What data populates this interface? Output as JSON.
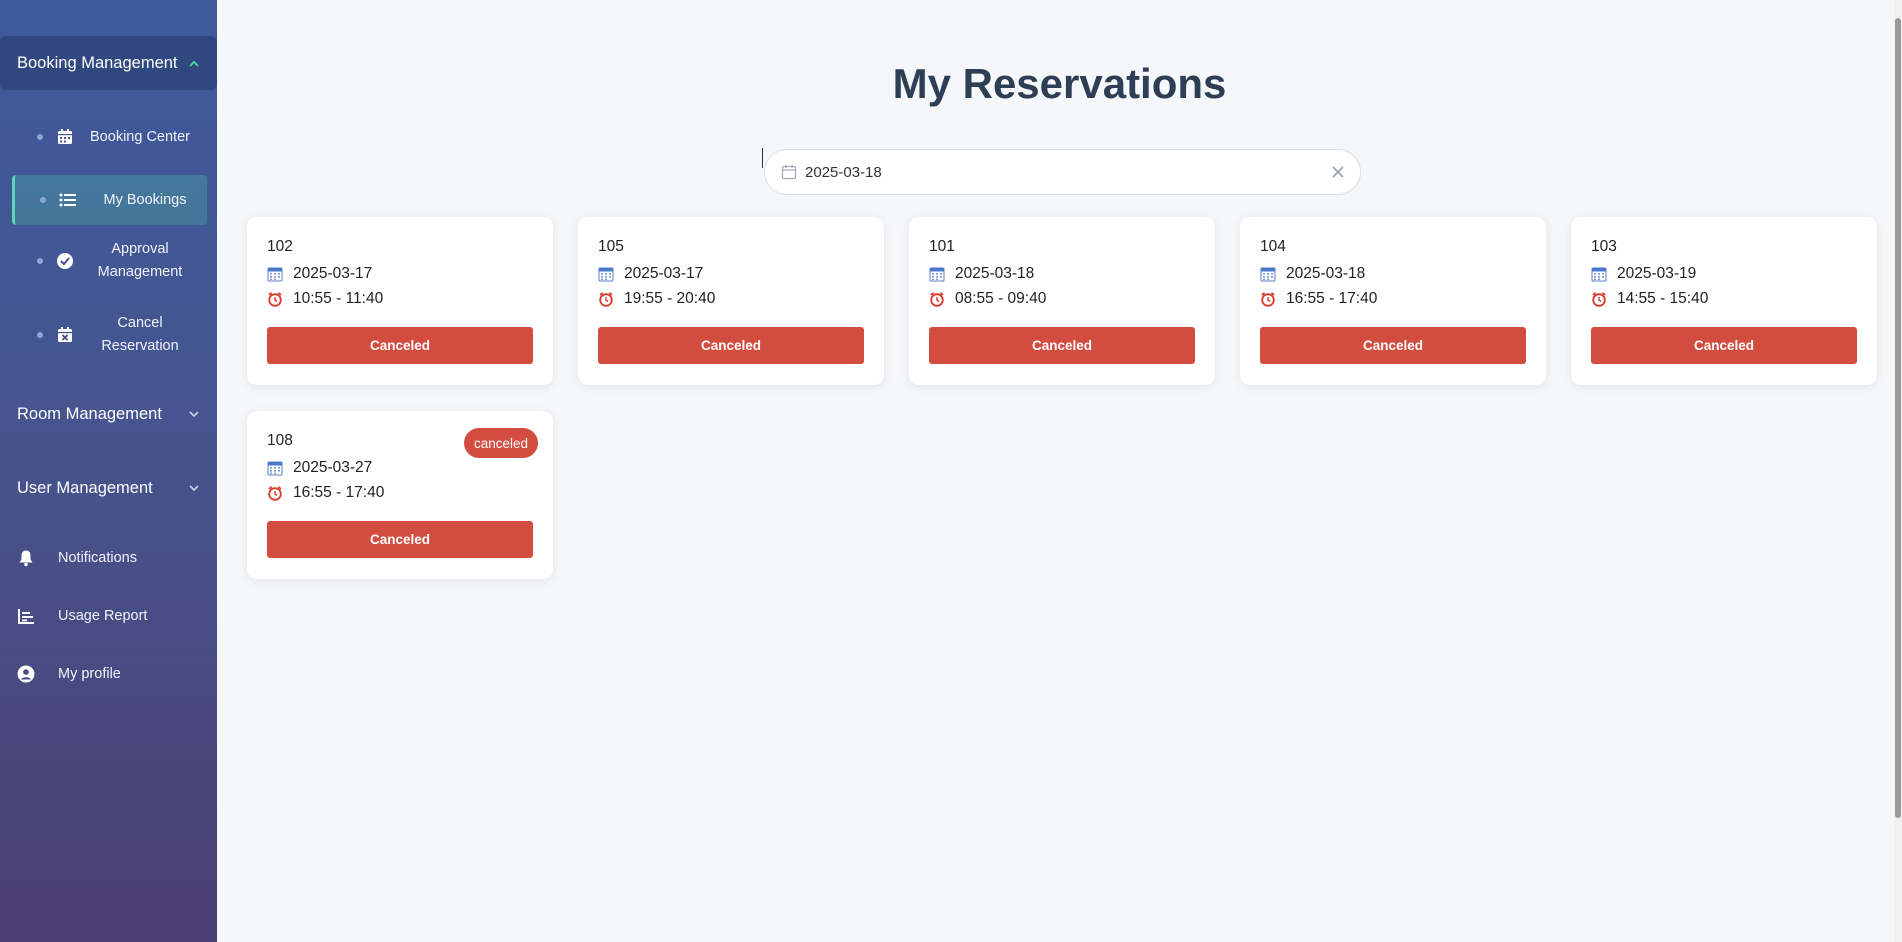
{
  "sidebar": {
    "booking_management": {
      "label": "Booking Management",
      "items": [
        {
          "label": "Booking Center",
          "icon": "calendar-icon"
        },
        {
          "label": "My Bookings",
          "icon": "list-icon"
        },
        {
          "label": "Approval Management",
          "icon": "check-circle-icon"
        },
        {
          "label": "Cancel Reservation",
          "icon": "calendar-x-icon"
        }
      ]
    },
    "room_management": {
      "label": "Room Management"
    },
    "user_management": {
      "label": "User Management"
    },
    "nav": [
      {
        "label": "Notifications",
        "icon": "bell-icon"
      },
      {
        "label": "Usage Report",
        "icon": "bar-chart-icon"
      },
      {
        "label": "My profile",
        "icon": "user-circle-icon"
      }
    ]
  },
  "page": {
    "title": "My Reservations"
  },
  "date_filter": {
    "value": "2025-03-18",
    "clear_icon": "close-icon"
  },
  "reservations": [
    {
      "room": "102",
      "date": "2025-03-17",
      "time": "10:55 - 11:40",
      "action": "Canceled"
    },
    {
      "room": "105",
      "date": "2025-03-17",
      "time": "19:55 - 20:40",
      "action": "Canceled"
    },
    {
      "room": "101",
      "date": "2025-03-18",
      "time": "08:55 - 09:40",
      "action": "Canceled"
    },
    {
      "room": "104",
      "date": "2025-03-18",
      "time": "16:55 - 17:40",
      "action": "Canceled"
    },
    {
      "room": "103",
      "date": "2025-03-19",
      "time": "14:55 - 15:40",
      "action": "Canceled"
    },
    {
      "room": "108",
      "date": "2025-03-27",
      "time": "16:55 - 17:40",
      "action": "Canceled",
      "badge": "canceled"
    }
  ],
  "colors": {
    "accent": "#d34c40",
    "title": "#2d3e55",
    "active": "#5ad8b4"
  }
}
